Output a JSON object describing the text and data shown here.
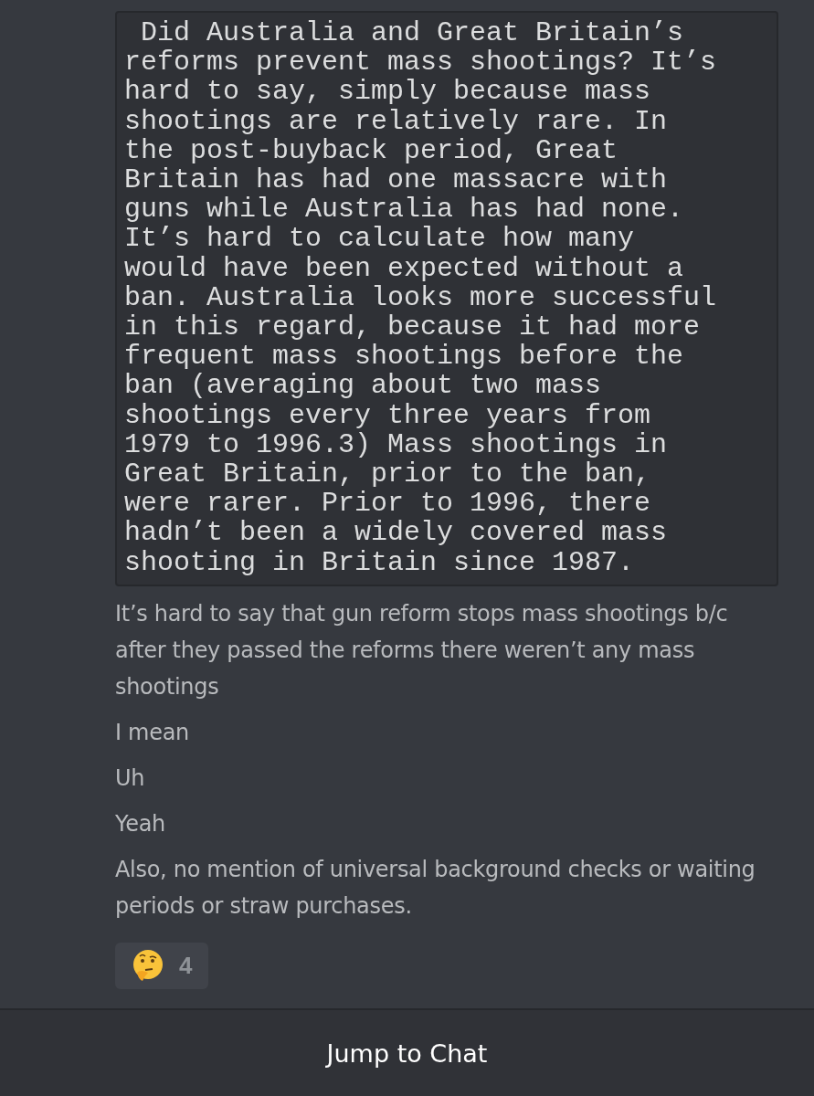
{
  "code_block": {
    "lines": [
      " Did Australia and Great Britain’s",
      "reforms prevent mass shootings? It’s",
      "hard to say, simply because mass",
      "shootings are relatively rare. In",
      "the post-buyback period, Great",
      "Britain has had one massacre with",
      "guns while Australia has had none.",
      "It’s hard to calculate how many",
      "would have been expected without a",
      "ban. Australia looks more successful",
      "in this regard, because it had more",
      "frequent mass shootings before the",
      "ban (averaging about two mass",
      "shootings every three years from",
      "1979 to 1996.3) Mass shootings in",
      "Great Britain, prior to the ban,",
      "were rarer. Prior to 1996, there",
      "hadn’t been a widely covered mass",
      "shooting in Britain since 1987."
    ]
  },
  "messages": [
    "It’s hard to say that gun reform stops mass shootings b/c after they  passed the reforms there weren’t any mass shootings",
    "I mean",
    "Uh",
    "Yeah",
    "Also, no mention of universal background checks or waiting periods or straw purchases."
  ],
  "reaction": {
    "count": "4"
  },
  "footer": {
    "button": "Jump to Chat"
  }
}
